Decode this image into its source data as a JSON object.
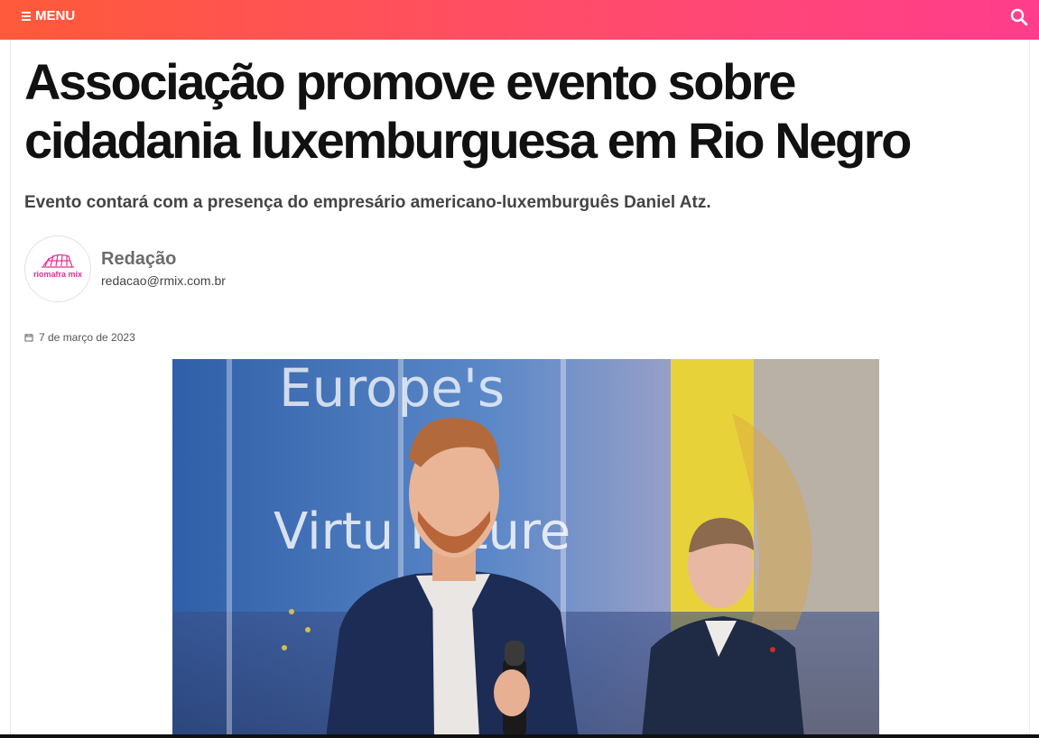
{
  "header": {
    "menu_label": "MENU",
    "menu_icon": "hamburger-icon",
    "search_icon": "search-icon",
    "gradient_start": "#ff5a3a",
    "gradient_end": "#ff3d8c"
  },
  "article": {
    "title": "Associação promove evento sobre cidadania luxemburguesa em Rio Negro",
    "subtitle": "Evento contará com a presença do empresário americano-luxemburguês Daniel Atz.",
    "date": "7 de março de 2023",
    "date_icon": "calendar-icon"
  },
  "author": {
    "name": "Redação",
    "email": "redacao@rmix.com.br",
    "avatar_text": "riomafra mix"
  },
  "hero_image": {
    "screen_text_line1": "Europe's",
    "screen_text_line2": "Virtu   Future"
  }
}
